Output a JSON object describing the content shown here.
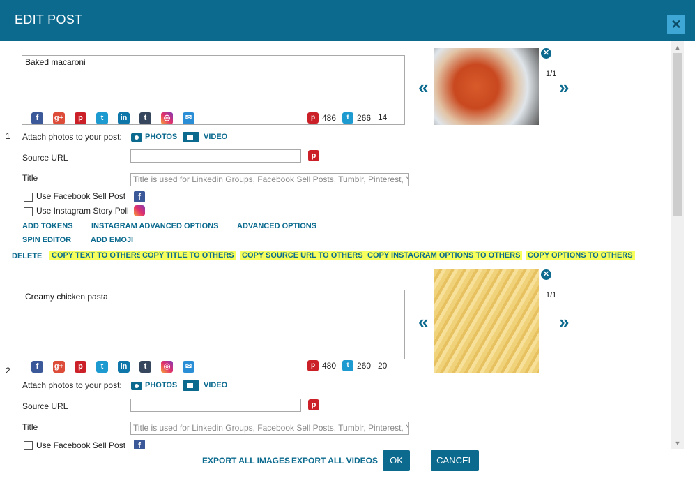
{
  "dialog": {
    "title": "EDIT POST",
    "close_icon": "close-icon",
    "accent_color": "#0b6a8e",
    "highlight_color": "#f6ff5b"
  },
  "posts": [
    {
      "index": "1",
      "text": "Baked macaroni",
      "pinterest_count": "486",
      "twitter_count": "266",
      "char_count": "14",
      "attach_label": "Attach photos to your post:",
      "photos_label": "PHOTOS",
      "video_label": "VIDEO",
      "source_url_label": "Source URL",
      "source_url_value": "",
      "title_label": "Title",
      "title_placeholder": "Title is used for Linkedin Groups, Facebook Sell Posts, Tumblr, Pinterest, Yo",
      "fb_sell_label": "Use Facebook Sell Post",
      "ig_story_label": "Use Instagram Story Poll",
      "image_counter": "1/1"
    },
    {
      "index": "2",
      "text": "Creamy chicken pasta",
      "pinterest_count": "480",
      "twitter_count": "260",
      "char_count": "20",
      "attach_label": "Attach photos to your post:",
      "photos_label": "PHOTOS",
      "video_label": "VIDEO",
      "source_url_label": "Source URL",
      "source_url_value": "",
      "title_label": "Title",
      "title_placeholder": "Title is used for Linkedin Groups, Facebook Sell Posts, Tumblr, Pinterest, Yo",
      "fb_sell_label": "Use Facebook Sell Post",
      "image_counter": "1/1"
    }
  ],
  "options": {
    "add_tokens": "ADD TOKENS",
    "instagram_advanced": "INSTAGRAM ADVANCED OPTIONS",
    "advanced": "ADVANCED OPTIONS",
    "spin_editor": "SPIN EDITOR",
    "add_emoji": "ADD EMOJI"
  },
  "copy_actions": {
    "delete": "DELETE",
    "copy_text": "COPY TEXT TO OTHERS",
    "copy_title": "COPY TITLE TO OTHERS",
    "copy_source": "COPY SOURCE URL TO OTHERS",
    "copy_instagram": "COPY INSTAGRAM OPTIONS TO OTHERS",
    "copy_options": "COPY OPTIONS TO OTHERS"
  },
  "social_icons": [
    "facebook-icon",
    "google-plus-icon",
    "pinterest-icon",
    "twitter-icon",
    "linkedin-icon",
    "tumblr-icon",
    "instagram-icon",
    "email-icon"
  ],
  "footer": {
    "export_images": "EXPORT ALL IMAGES",
    "export_videos": "EXPORT ALL VIDEOS",
    "ok": "OK",
    "cancel": "CANCEL"
  }
}
